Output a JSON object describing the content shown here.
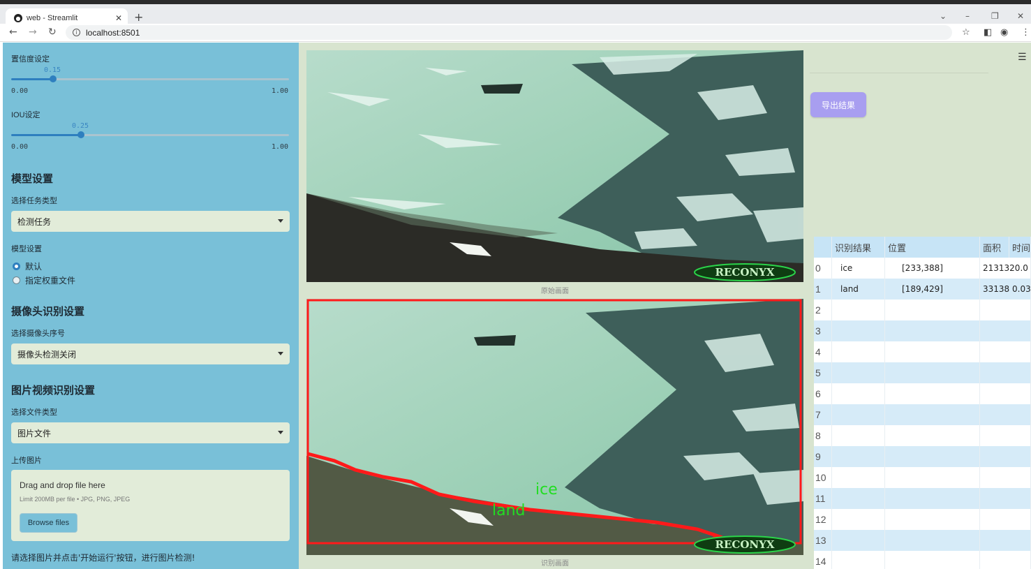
{
  "browser": {
    "tab_title": "web - Streamlit",
    "url": "localhost:8501"
  },
  "sidebar": {
    "confidence": {
      "label": "置信度设定",
      "value": 0.15,
      "value_text": "0.15",
      "min": "0.00",
      "max": "1.00"
    },
    "iou": {
      "label": "IOU设定",
      "value": 0.25,
      "value_text": "0.25",
      "min": "0.00",
      "max": "1.00"
    },
    "model_settings_head": "模型设置",
    "task_type_label": "选择任务类型",
    "task_type_value": "检测任务",
    "model_settings_label": "模型设置",
    "radio_default": "默认",
    "radio_weights": "指定权重文件",
    "camera_head": "摄像头识别设置",
    "camera_label": "选择摄像头序号",
    "camera_value": "摄像头检测关闭",
    "media_head": "图片视频识别设置",
    "file_type_label": "选择文件类型",
    "file_type_value": "图片文件",
    "upload_label": "上传图片",
    "upload_drag": "Drag and drop file here",
    "upload_limit": "Limit 200MB per file • JPG, PNG, JPEG",
    "browse_button": "Browse files",
    "hint": "请选择图片并点击'开始运行'按钮，进行图片检测!"
  },
  "main": {
    "original_caption": "原始画面",
    "detect_caption": "识别画面",
    "watermark": "RECONYX",
    "detections": [
      {
        "label": "ice",
        "color": "#22dd22"
      },
      {
        "label": "land",
        "color": "#22dd22"
      }
    ],
    "box_color": "#ff1a1a"
  },
  "right": {
    "export_button": "导出结果",
    "table": {
      "headers": [
        "识别结果",
        "位置",
        "面积",
        "时间"
      ],
      "rows": [
        {
          "index": "0",
          "result": "ice",
          "position": "[233,388]",
          "area": "2131320.0"
        },
        {
          "index": "1",
          "result": "land",
          "position": "[189,429]",
          "area": "33138 0.03"
        },
        {
          "index": "2"
        },
        {
          "index": "3"
        },
        {
          "index": "4"
        },
        {
          "index": "5"
        },
        {
          "index": "6"
        },
        {
          "index": "7"
        },
        {
          "index": "8"
        },
        {
          "index": "9"
        },
        {
          "index": "10"
        },
        {
          "index": "11"
        },
        {
          "index": "12"
        },
        {
          "index": "13"
        },
        {
          "index": "14"
        }
      ]
    }
  }
}
